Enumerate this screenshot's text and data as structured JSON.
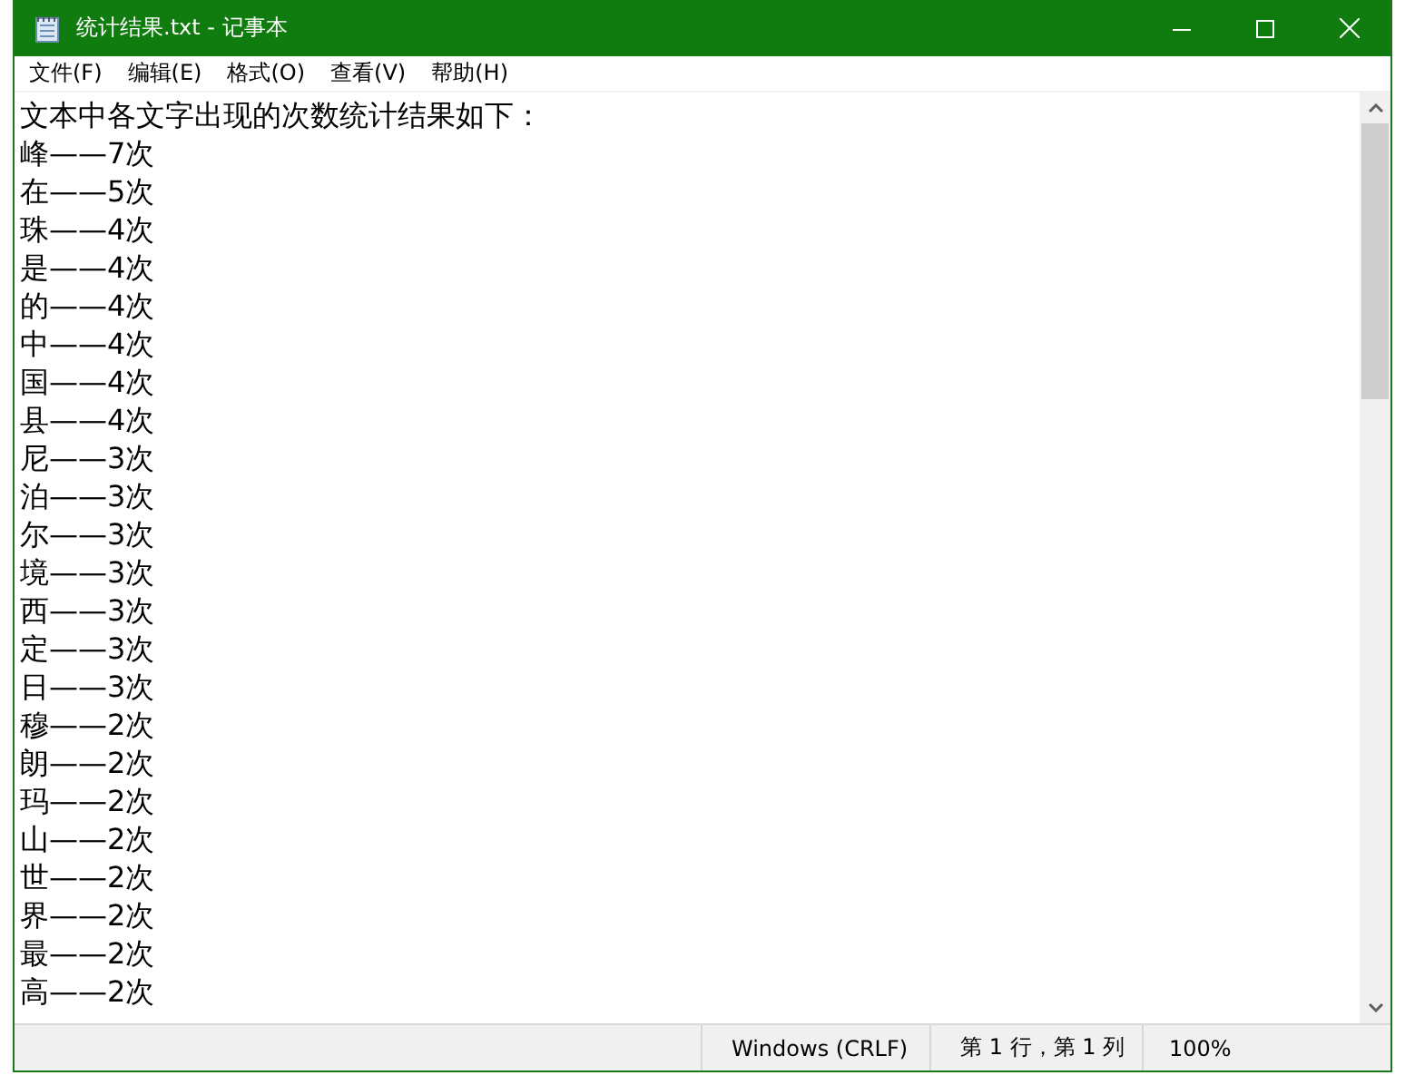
{
  "window": {
    "title": "统计结果.txt - 记事本"
  },
  "menu": [
    {
      "label": "文件(F)"
    },
    {
      "label": "编辑(E)"
    },
    {
      "label": "格式(O)"
    },
    {
      "label": "查看(V)"
    },
    {
      "label": "帮助(H)"
    }
  ],
  "editor": {
    "lines": [
      "文本中各文字出现的次数统计结果如下：",
      "峰——7次",
      "在——5次",
      "珠——4次",
      "是——4次",
      "的——4次",
      "中——4次",
      "国——4次",
      "县——4次",
      "尼——3次",
      "泊——3次",
      "尔——3次",
      "境——3次",
      "西——3次",
      "定——3次",
      "日——3次",
      "穆——2次",
      "朗——2次",
      "玛——2次",
      "山——2次",
      "世——2次",
      "界——2次",
      "最——2次",
      "高——2次"
    ]
  },
  "status_bar": {
    "line_ending": "Windows (CRLF)",
    "position": "第 1 行，第 1 列",
    "zoom": "100%"
  }
}
